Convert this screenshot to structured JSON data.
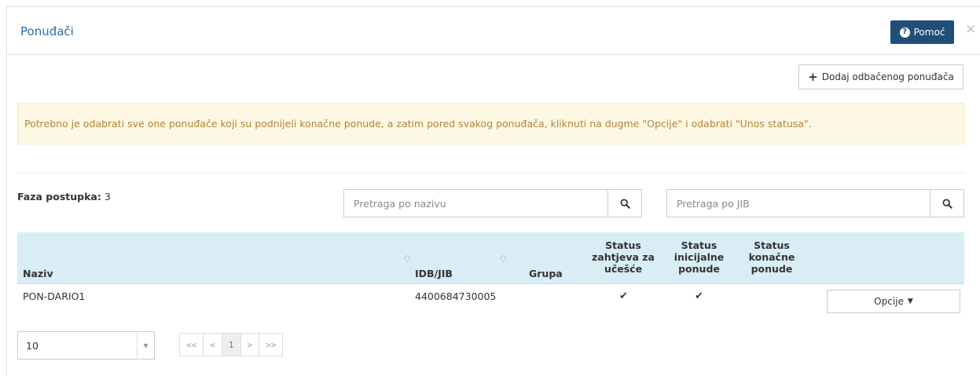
{
  "header": {
    "title": "Ponuđači",
    "help_label": "Pomoć",
    "close_glyph": "×"
  },
  "toolbar": {
    "add_label": "Dodaj odbačenog ponuđača"
  },
  "alert": {
    "text": "Potrebno je odabrati sve one ponuđače koji su podnijeli konačne ponude, a zatim pored svakog ponuđača, kliknuti na dugme \"Opcije\" i odabrati \"Unos statusa\"."
  },
  "phase": {
    "label": "Faza postupka:",
    "value": "3"
  },
  "search": {
    "name_placeholder": "Pretraga po nazivu",
    "jib_placeholder": "Pretraga po JIB"
  },
  "table": {
    "columns": {
      "naziv": "Naziv",
      "idb": "IDB/JIB",
      "grupa": "Grupa",
      "status1": [
        "Status",
        "zahtjeva za",
        "učešće"
      ],
      "status2": [
        "Status",
        "inicijalne",
        "ponude"
      ],
      "status3": [
        "Status",
        "konačne",
        "ponude"
      ]
    },
    "rows": [
      {
        "naziv": "PON-DARIO1",
        "idb": "4400684730005",
        "grupa": "",
        "status1": true,
        "status2": true,
        "status3": false,
        "options_label": "Opcije"
      }
    ]
  },
  "pagination": {
    "page_size": "10",
    "first": "<<",
    "prev": "<",
    "current": "1",
    "next": ">",
    "last": ">>"
  },
  "colors": {
    "accent": "#1f4e79",
    "title": "#2a6fa8",
    "alert_bg": "#fcf8e3",
    "alert_text": "#b2843b",
    "table_head_bg": "#d9edf7"
  },
  "icons": {
    "help": "question-circle-icon",
    "close": "close-icon",
    "add": "plus-icon",
    "search": "search-icon",
    "check": "check-icon",
    "caret": "caret-down-icon",
    "sort": "sort-icon"
  }
}
